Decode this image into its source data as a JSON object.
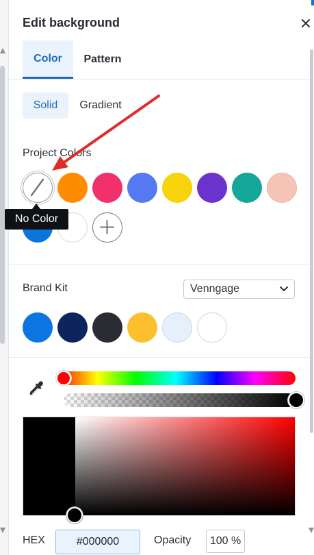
{
  "panel": {
    "title": "Edit background"
  },
  "tabs": [
    {
      "label": "Color",
      "active": true
    },
    {
      "label": "Pattern",
      "active": false
    }
  ],
  "fill_modes": [
    {
      "label": "Solid",
      "active": true
    },
    {
      "label": "Gradient",
      "active": false
    }
  ],
  "project_colors": {
    "label": "Project Colors",
    "tooltip": "No Color",
    "swatches": [
      {
        "name": "no-color",
        "color": "none"
      },
      {
        "name": "orange",
        "color": "#ff8c00"
      },
      {
        "name": "pink",
        "color": "#f1316b"
      },
      {
        "name": "blue",
        "color": "#5479f1"
      },
      {
        "name": "yellow",
        "color": "#f6d30a"
      },
      {
        "name": "purple",
        "color": "#6c32ce"
      },
      {
        "name": "teal",
        "color": "#13a699"
      },
      {
        "name": "peach",
        "color": "#f5c4b6"
      },
      {
        "name": "bright-blue",
        "color": "#0a76dc"
      },
      {
        "name": "white",
        "color": "#ffffff"
      }
    ],
    "add_icon": "plus-icon"
  },
  "brand_kit": {
    "label": "Brand Kit",
    "selected": "Venngage",
    "swatches": [
      "#0b76e0",
      "#0d255c",
      "#2a2b33",
      "#fcc02f",
      "#e5f0fc",
      "#ffffff"
    ]
  },
  "picker": {
    "hue_color": "#ff0000",
    "opacity_percent": 100,
    "hex_label": "HEX",
    "hex_value": "#000000",
    "opacity_label": "Opacity",
    "opacity_value": "100 %"
  },
  "colors": {
    "accent": "#0a76dc",
    "active_tab_text": "#1f6ab6",
    "active_bg": "#eaf3fc",
    "annotation_arrow": "#e02b2b"
  }
}
